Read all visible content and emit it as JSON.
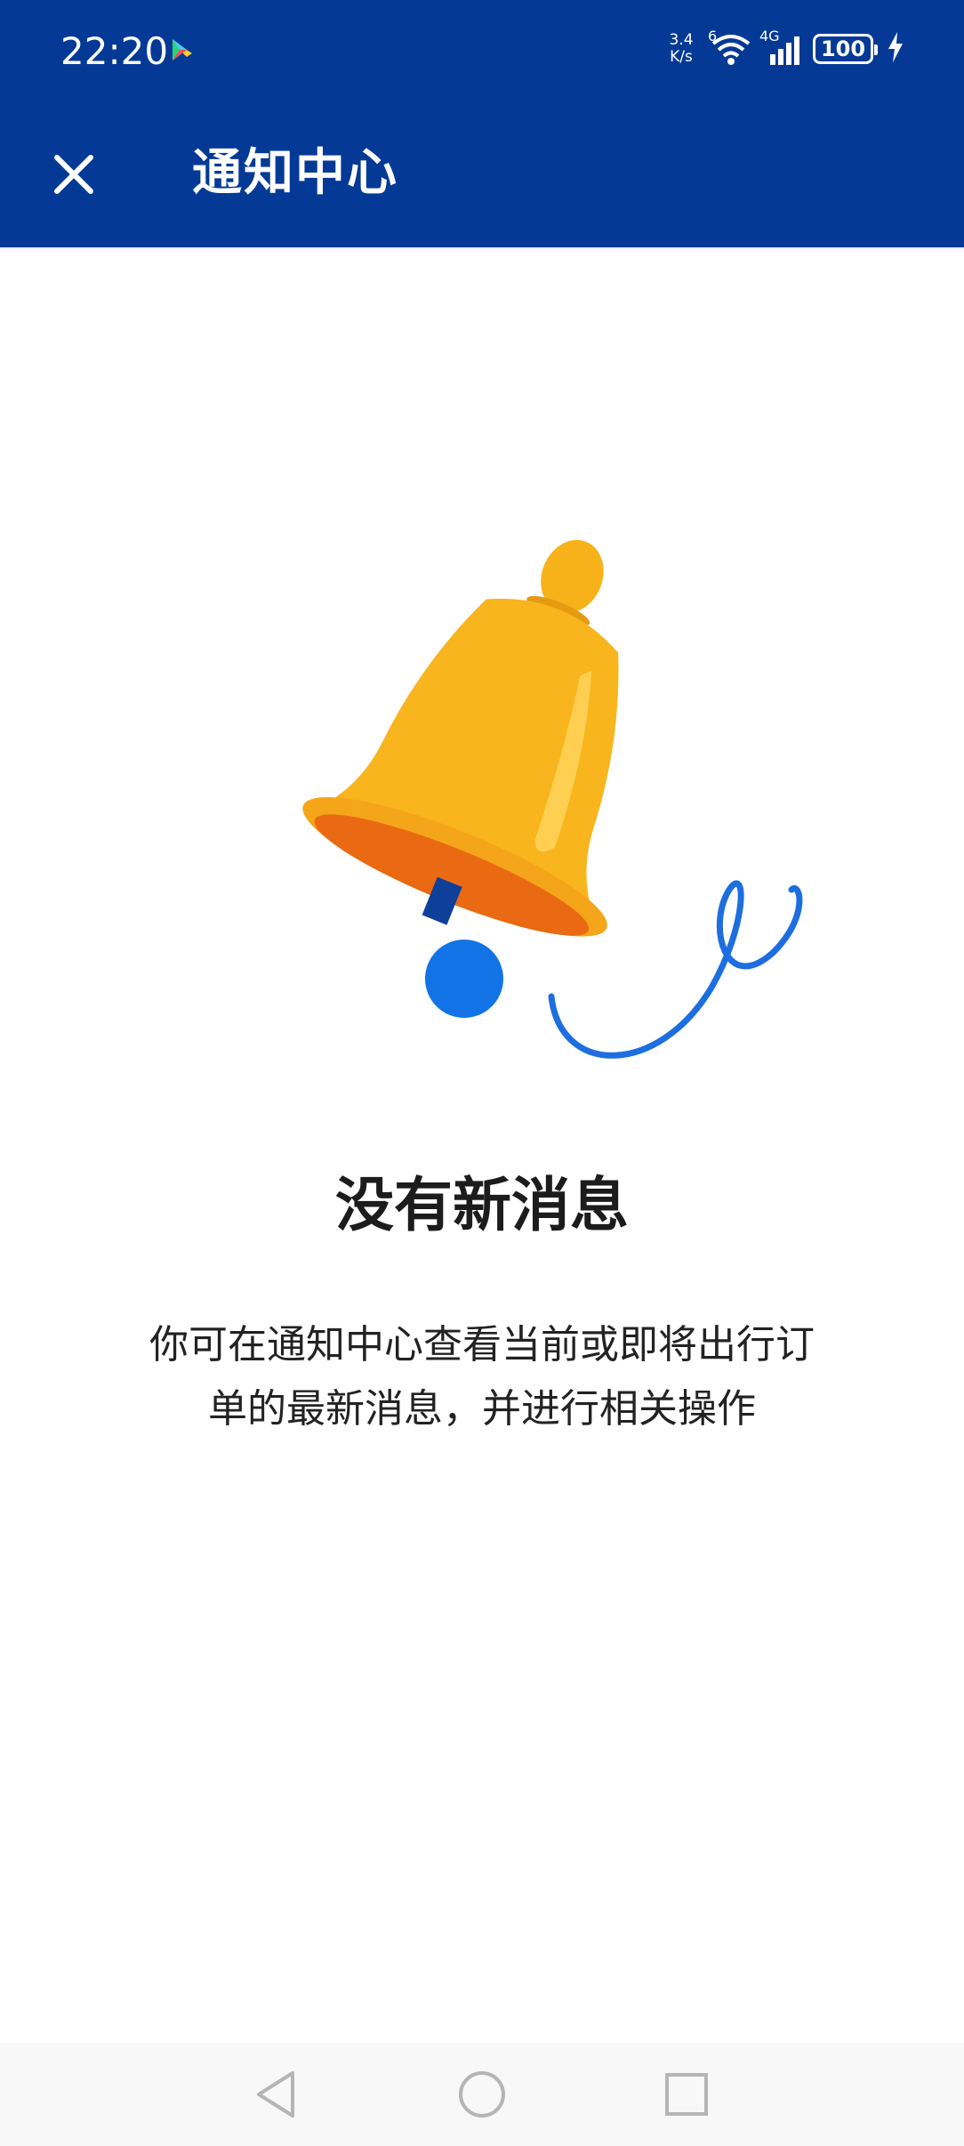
{
  "status_bar": {
    "time": "22:20",
    "net_speed_value": "3.4",
    "net_speed_unit": "K/s",
    "wifi_label": "6",
    "cell_label": "4G",
    "battery_level": "100",
    "icons": [
      "play-store-icon",
      "wifi-icon",
      "cellular-signal-icon",
      "battery-icon",
      "charging-icon"
    ]
  },
  "app_bar": {
    "title": "通知中心",
    "close_icon": "close-icon"
  },
  "empty_state": {
    "illustration": "bell-icon",
    "title": "没有新消息",
    "description_line1": "你可在通知中心查看当前或即将出行订",
    "description_line2": "单的最新消息，并进行相关操作"
  },
  "nav_bar": {
    "icons": [
      "back-triangle-icon",
      "home-circle-icon",
      "recents-square-icon"
    ]
  },
  "colors": {
    "header_bg": "#043a96",
    "bell_main": "#f7b21a",
    "bell_inner": "#ea6a10",
    "clapper": "#1273e6",
    "text_primary": "#1c1c1c"
  }
}
